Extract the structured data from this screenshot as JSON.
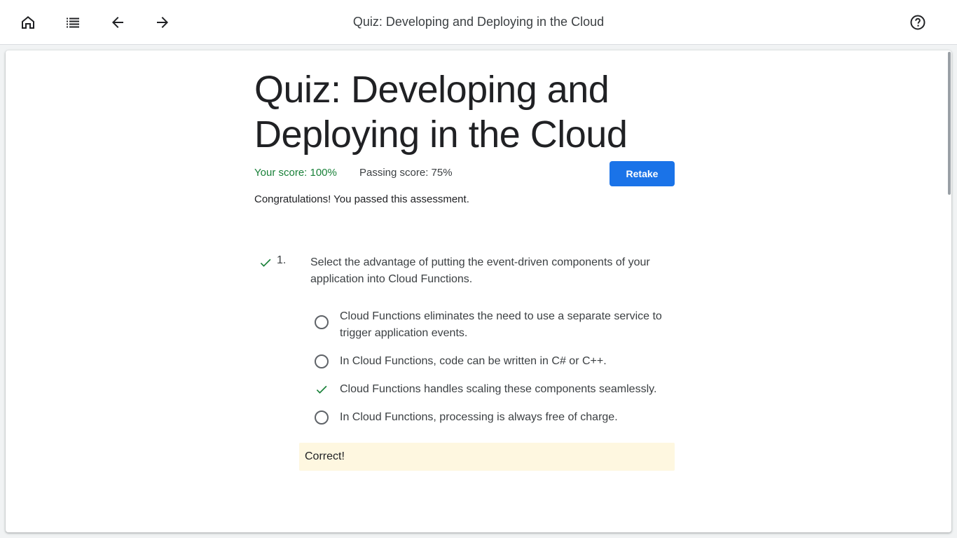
{
  "topbar": {
    "title": "Quiz: Developing and Deploying in the Cloud",
    "icons": [
      "home-icon",
      "list-icon",
      "arrow-back-icon",
      "arrow-forward-icon",
      "help-icon"
    ]
  },
  "quiz": {
    "title": "Quiz: Developing and Deploying in the Cloud",
    "your_score": "Your score: 100%",
    "passing_score": "Passing score: 75%",
    "retake_label": "Retake",
    "congrats": "Congratulations! You passed this assessment."
  },
  "question": {
    "number": "1.",
    "text": "Select the advantage of putting the event-driven components of your application into Cloud Functions.",
    "options": [
      {
        "text": "Cloud Functions eliminates the need to use a separate service to trigger application events.",
        "state": "unselected"
      },
      {
        "text": "In Cloud Functions, code can be written in C# or C++.",
        "state": "unselected"
      },
      {
        "text": "Cloud Functions handles scaling these components seamlessly.",
        "state": "correct"
      },
      {
        "text": "In Cloud Functions, processing is always free of charge.",
        "state": "unselected"
      }
    ],
    "feedback": "Correct!"
  },
  "colors": {
    "accent": "#1a73e8",
    "success": "#188038",
    "feedback_bg": "#fef7e0"
  }
}
